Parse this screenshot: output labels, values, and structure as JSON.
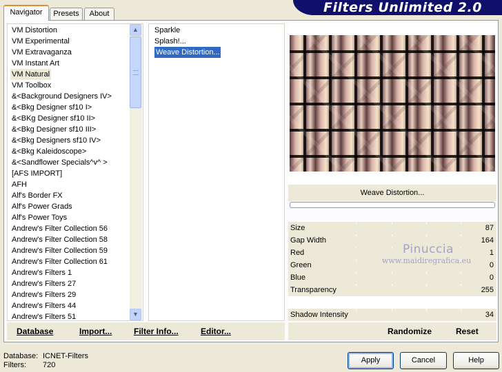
{
  "app": {
    "title": "Filters Unlimited 2.0"
  },
  "tabs": [
    {
      "label": "Navigator",
      "active": true
    },
    {
      "label": "Presets",
      "active": false
    },
    {
      "label": "About",
      "active": false
    }
  ],
  "filter_list": {
    "items": [
      "VM Distortion",
      "VM Experimental",
      "VM Extravaganza",
      "VM Instant Art",
      "VM Natural",
      "VM Toolbox",
      "&<Background Designers IV>",
      "&<Bkg Designer sf10 I>",
      "&<BKg Designer sf10 II>",
      "&<Bkg Designer sf10 III>",
      "&<Bkg Designers sf10 IV>",
      "&<Bkg Kaleidoscope>",
      "&<Sandflower Specials^v^ >",
      "[AFS IMPORT]",
      "AFH",
      "Alf's Border FX",
      "Alf's Power Grads",
      "Alf's Power Toys",
      "Andrew's Filter Collection 56",
      "Andrew's Filter Collection 58",
      "Andrew's Filter Collection 59",
      "Andrew's Filter Collection 61",
      "Andrew's Filters 1",
      "Andrew's Filters 27",
      "Andrew's Filters 29",
      "Andrew's Filters 44",
      "Andrew's Filters 51"
    ],
    "selected": "VM Natural"
  },
  "sub_filters": {
    "items": [
      "Sparkle",
      "Splash!...",
      "Weave Distortion..."
    ],
    "selected": "Weave Distortion..."
  },
  "preview": {
    "filter_name": "Weave Distortion...",
    "progress_percent": 0
  },
  "params": [
    {
      "label": "Size",
      "value": "87"
    },
    {
      "label": "Gap Width",
      "value": "164"
    },
    {
      "label": "Red",
      "value": "1"
    },
    {
      "label": "Green",
      "value": "0"
    },
    {
      "label": "Blue",
      "value": "0"
    },
    {
      "label": "Transparency",
      "value": "255"
    },
    {
      "label": "",
      "value": ""
    },
    {
      "label": "Shadow Intensity",
      "value": "34"
    }
  ],
  "watermark": {
    "line1": "Pinuccia",
    "line2": "www.maidiregrafica.eu"
  },
  "bottom_links": {
    "database": "Database",
    "import": "Import...",
    "filter_info": "Filter Info...",
    "editor": "Editor...",
    "randomize": "Randomize",
    "reset": "Reset"
  },
  "footer": {
    "database_label": "Database:",
    "database_value": "ICNET-Filters",
    "filters_label": "Filters:",
    "filters_value": "720"
  },
  "buttons": {
    "apply": "Apply",
    "cancel": "Cancel",
    "help": "Help"
  },
  "icons": {
    "scroll_up": "chevron-up-icon",
    "scroll_down": "chevron-down-icon"
  }
}
